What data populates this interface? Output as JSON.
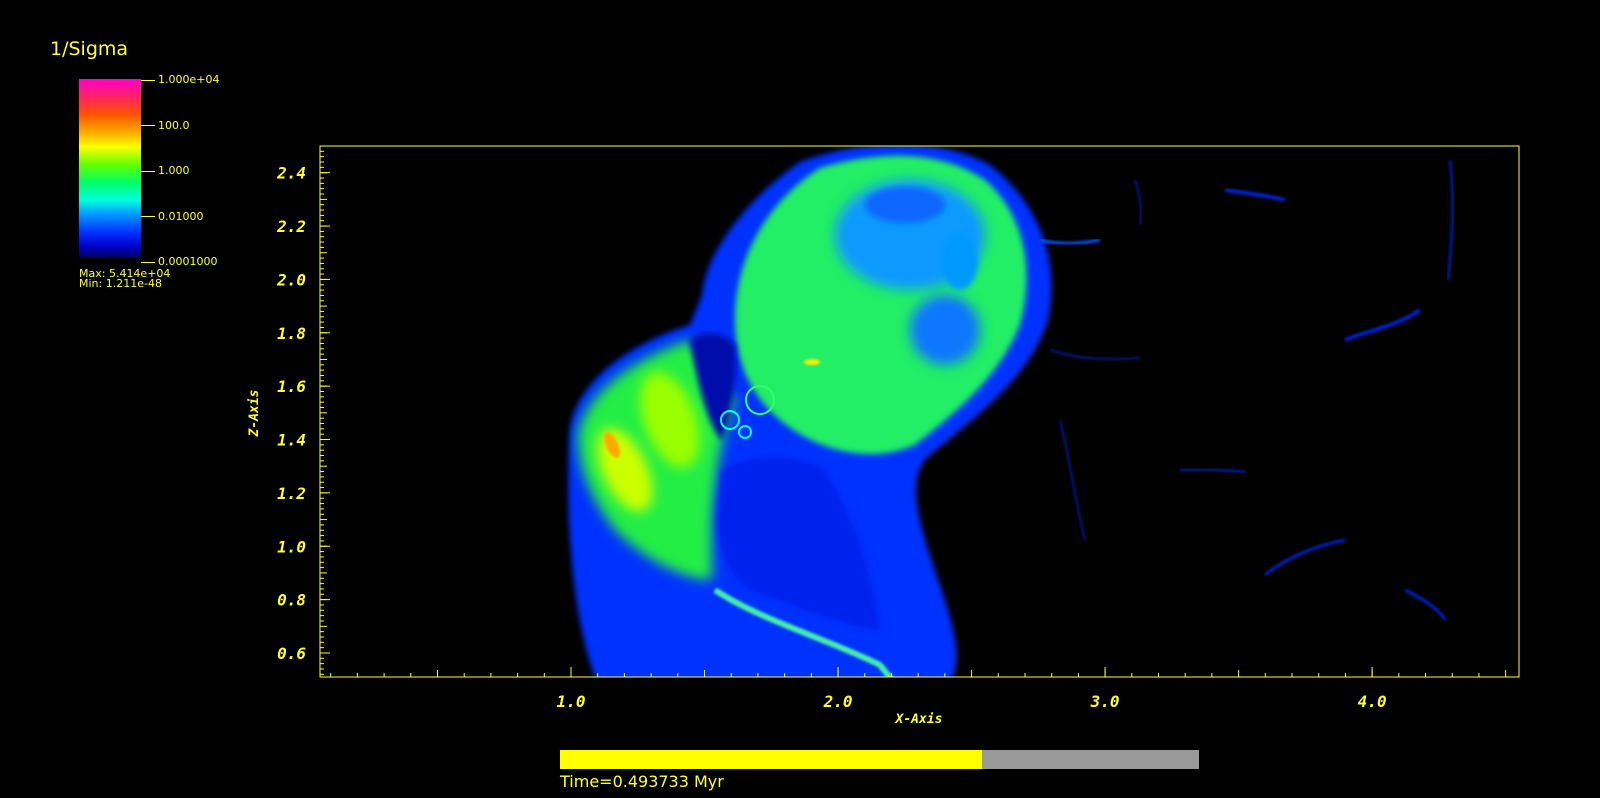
{
  "legend": {
    "title": "1/Sigma",
    "labels": [
      "1.000e+04",
      "100.0",
      "1.000",
      "0.01000",
      "0.0001000"
    ],
    "max_text": "Max:  5.414e+04",
    "min_text": "Min:  1.211e-48"
  },
  "colors": {
    "axis": "#ffff33",
    "background": "#000000"
  },
  "chart_data": {
    "type": "heatmap",
    "title": "",
    "xlabel": "X-Axis",
    "ylabel": "Z-Axis",
    "xlim": [
      0.06,
      4.55
    ],
    "ylim": [
      0.51,
      2.5
    ],
    "x_ticks": [
      "1.0",
      "2.0",
      "3.0",
      "4.0"
    ],
    "y_ticks": [
      "0.6",
      "0.8",
      "1.0",
      "1.2",
      "1.4",
      "1.6",
      "1.8",
      "2.0",
      "2.2",
      "2.4"
    ],
    "colorbar": {
      "scale": "log",
      "min": 0.0001,
      "max": 10000
    }
  },
  "time": {
    "label": "Time=0.493733 Myr",
    "progress": 0.66
  }
}
